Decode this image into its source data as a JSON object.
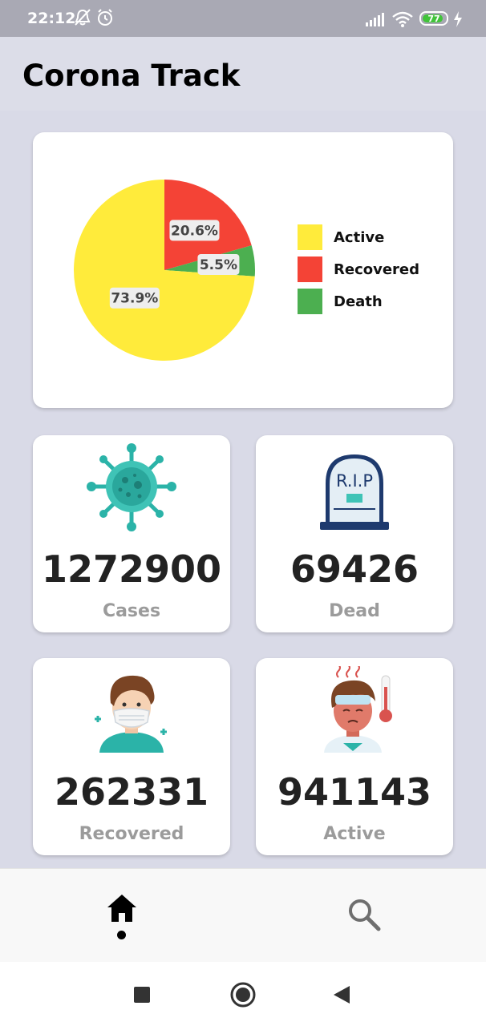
{
  "status_bar": {
    "time": "22:12",
    "battery": "77",
    "icons": [
      "muted-bell-icon",
      "alarm-icon",
      "signal-icon",
      "wifi-icon",
      "battery-icon",
      "charging-icon"
    ]
  },
  "app": {
    "title": "Corona Track"
  },
  "chart_data": {
    "type": "pie",
    "slices": [
      {
        "label": "Active",
        "value": 73.9,
        "display": "73.9%",
        "color": "#ffeb3b"
      },
      {
        "label": "Recovered",
        "value": 20.6,
        "display": "20.6%",
        "color": "#f44336"
      },
      {
        "label": "Death",
        "value": 5.5,
        "display": "5.5%",
        "color": "#4caf50"
      }
    ],
    "legend": [
      "Active",
      "Recovered",
      "Death"
    ],
    "legend_position": "right"
  },
  "stats": [
    {
      "value": "1272900",
      "label": "Cases",
      "icon": "virus-icon"
    },
    {
      "value": "69426",
      "label": "Dead",
      "icon": "tombstone-icon",
      "icon_text": "R.I.P"
    },
    {
      "value": "262331",
      "label": "Recovered",
      "icon": "masked-person-icon"
    },
    {
      "value": "941143",
      "label": "Active",
      "icon": "sick-person-icon"
    }
  ],
  "bottom_nav": {
    "items": [
      {
        "icon": "home-icon",
        "selected": true
      },
      {
        "icon": "search-icon",
        "selected": false
      }
    ]
  },
  "system_nav": [
    "recents-square-icon",
    "home-circle-icon",
    "back-triangle-icon"
  ]
}
